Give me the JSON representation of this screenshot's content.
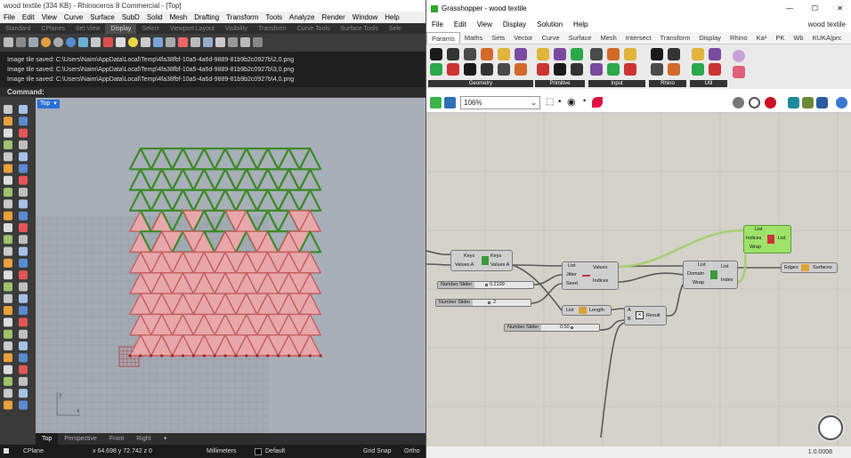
{
  "rhino": {
    "title": "wood textile (334 KB) - Rhinoceros 8 Commercial - [Top]",
    "menu": [
      "File",
      "Edit",
      "View",
      "Curve",
      "Surface",
      "SubD",
      "Solid",
      "Mesh",
      "Drafting",
      "Transform",
      "Tools",
      "Analyze",
      "Render",
      "Window",
      "Help"
    ],
    "tabs": [
      "Standard",
      "CPlanes",
      "Set View",
      "Display",
      "Select",
      "Viewport Layout",
      "Visibility",
      "Transform",
      "Curve Tools",
      "Surface Tools",
      "Sele"
    ],
    "active_tab": "Display",
    "history": [
      "Image tile saved: C:\\Users\\Naim\\AppData\\Local\\Temp\\4fa38fbf-10a5-4a6d-9889-81b9b2c0927b\\2,0.png",
      "Image tile saved: C:\\Users\\Naim\\AppData\\Local\\Temp\\4fa38fbf-10a5-4a6d-9889-81b9b2c0927b\\3,0.png",
      "Image tile saved: C:\\Users\\Naim\\AppData\\Local\\Temp\\4fa38fbf-10a5-4a6d-9889-81b9b2c0927b\\4,0.png"
    ],
    "command_label": "Command:",
    "viewport_name": "Top",
    "viewport_tabs": [
      "Top",
      "Perspective",
      "Front",
      "Right",
      "+"
    ],
    "axis_y": "y",
    "axis_x": "x",
    "status": {
      "cplane": "CPlane",
      "coords": "x 64.698  y 72.742  z 0",
      "units": "Millimeters",
      "layer": "Default",
      "gridsnap": "Grid Snap",
      "ortho": "Ortho"
    },
    "colors": {
      "green": "#3f8a2a",
      "red": "#c45f62",
      "pink_fill": "#e8a7aa",
      "viewport_bg": "#a8afb9"
    }
  },
  "gh": {
    "title": "Grasshopper - wood textile",
    "doc_name": "wood textile",
    "menu": [
      "File",
      "Edit",
      "View",
      "Display",
      "Solution",
      "Help"
    ],
    "tabs": [
      "Params",
      "Maths",
      "Sets",
      "Vector",
      "Curve",
      "Surface",
      "Mesh",
      "Intersect",
      "Transform",
      "Display",
      "Rhino",
      "Ka²",
      "PK",
      "Wb",
      "KUKA|prc"
    ],
    "active_tab": "Params",
    "ribbon_groups": [
      "Geometry",
      "Primitive",
      "Input",
      "Rhino",
      "Util"
    ],
    "zoom": "106%",
    "version": "1.0.0008",
    "nodes": {
      "sortlist": {
        "in": [
          "Keys",
          "Values A"
        ],
        "out": [
          "Keys",
          "Values A"
        ]
      },
      "jitter": {
        "in": [
          "List",
          "Jitter",
          "Seed"
        ],
        "out": [
          "Values",
          "Indices"
        ]
      },
      "listlength": {
        "in": [
          "List"
        ],
        "out": [
          "Length"
        ]
      },
      "result": {
        "in": [
          "A",
          "B"
        ],
        "out": [
          "Result"
        ]
      },
      "listitem": {
        "in": [
          "List",
          "Domain",
          "Wrap"
        ],
        "out": [
          "List",
          "Index"
        ]
      },
      "listsel": {
        "in": [
          "List",
          "Indices",
          "Wrap"
        ],
        "out": [
          "List"
        ]
      },
      "edges": {
        "in": [
          "Edges"
        ],
        "out": [
          "Surfaces"
        ]
      }
    },
    "sliders": [
      {
        "label": "Number Slider",
        "value": "0.2199"
      },
      {
        "label": "Number Slider",
        "value": "2"
      },
      {
        "label": "Number Slider",
        "value": "0.50"
      }
    ]
  }
}
